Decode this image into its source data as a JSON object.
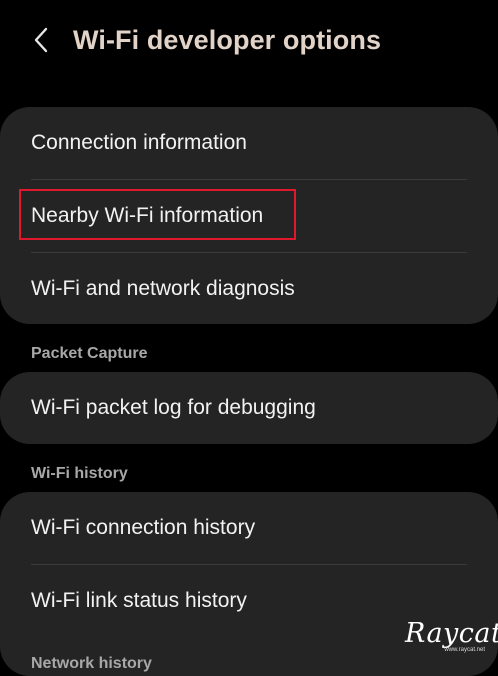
{
  "header": {
    "title": "Wi-Fi developer options",
    "back_icon": "chevron-left-icon"
  },
  "groups": [
    {
      "items": [
        {
          "label": "Connection information"
        },
        {
          "label": "Nearby Wi-Fi information",
          "highlighted": true
        },
        {
          "label": "Wi-Fi and network diagnosis"
        }
      ]
    },
    {
      "section": "Packet Capture",
      "items": [
        {
          "label": "Wi-Fi packet log for debugging"
        }
      ]
    },
    {
      "section": "Wi-Fi history",
      "items": [
        {
          "label": "Wi-Fi connection history"
        },
        {
          "label": "Wi-Fi link status history"
        }
      ]
    },
    {
      "section": "Network history"
    }
  ],
  "watermark": {
    "logo": "Raycat",
    "url": "www.raycat.net"
  },
  "colors": {
    "background": "#000000",
    "card": "#242424",
    "title": "#e2d3c8",
    "highlight": "#e0182d",
    "section_header": "#a8a8a8"
  }
}
